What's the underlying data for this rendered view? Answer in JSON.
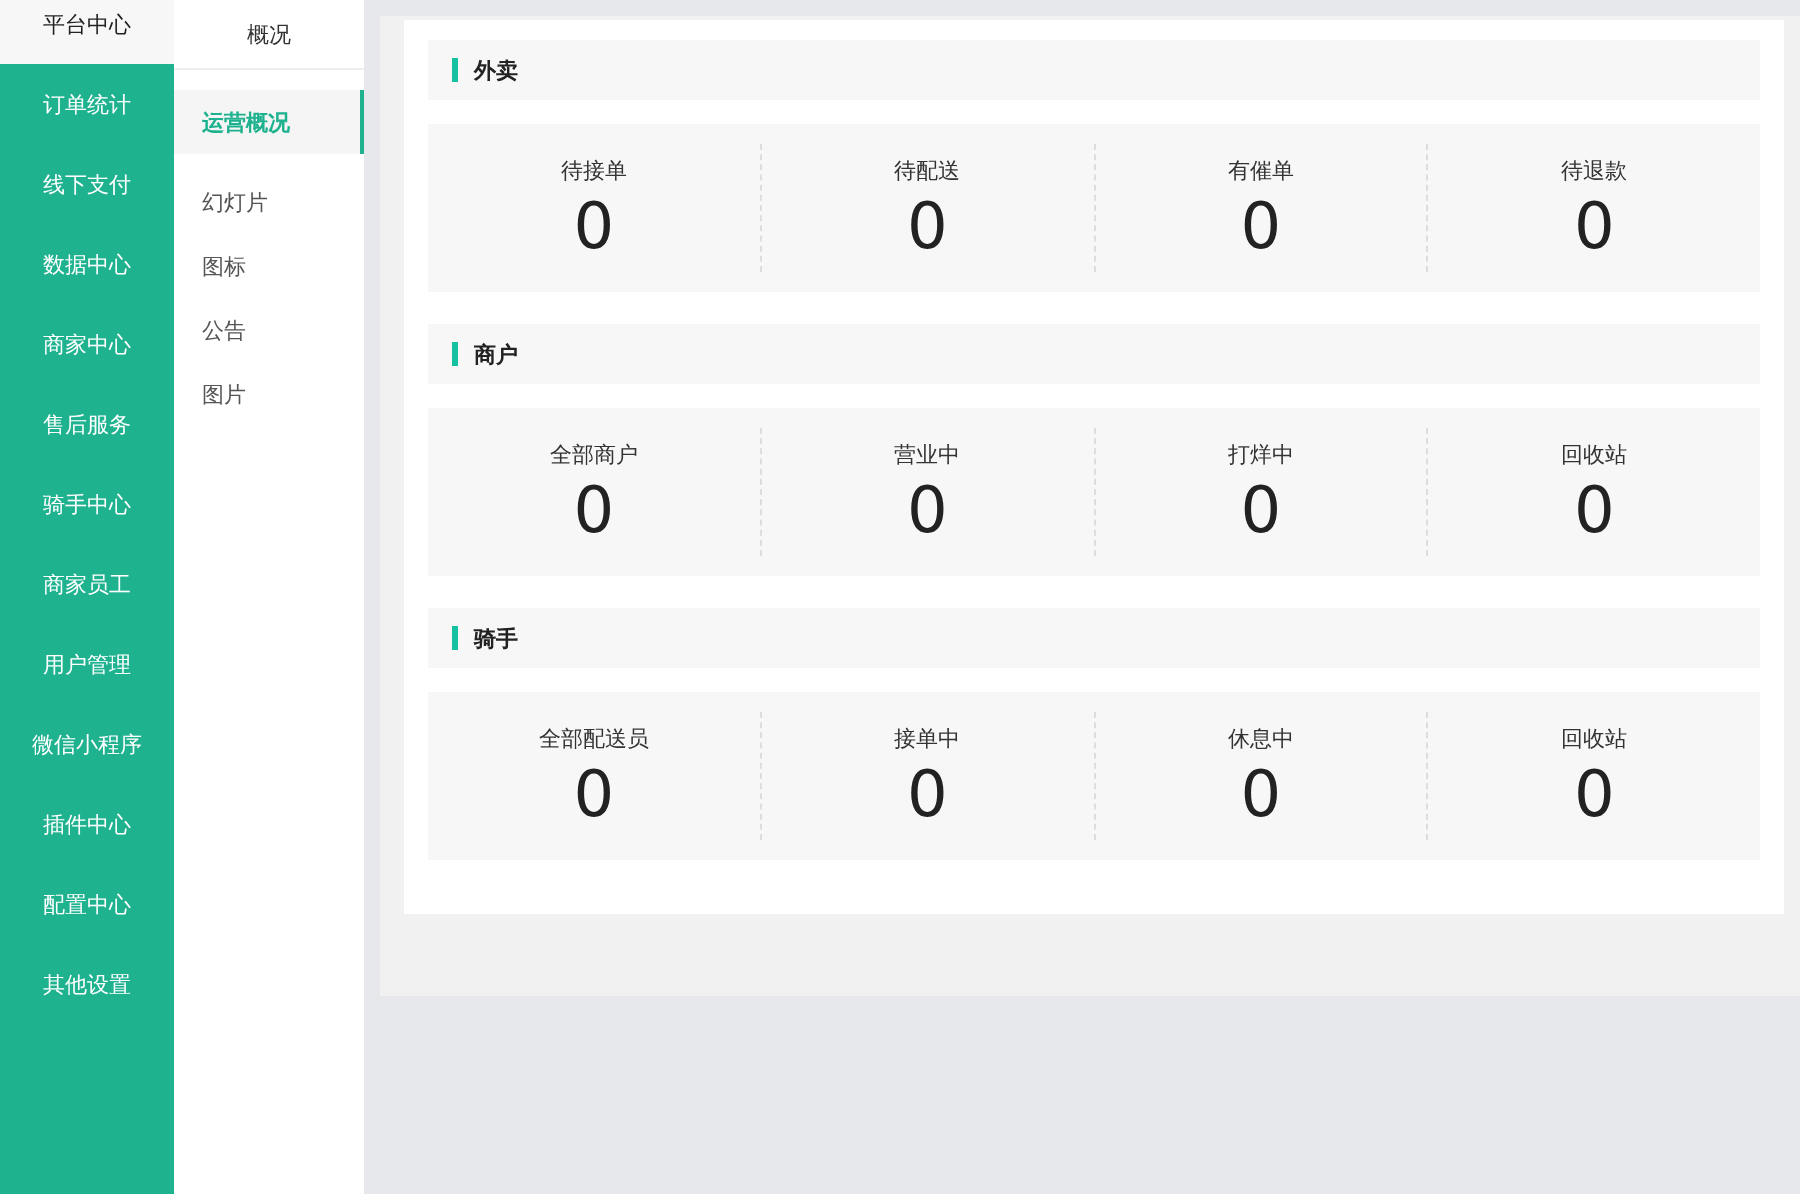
{
  "nav": [
    {
      "label": "平台中心",
      "selected": true
    },
    {
      "label": "订单统计",
      "selected": false
    },
    {
      "label": "线下支付",
      "selected": false
    },
    {
      "label": "数据中心",
      "selected": false
    },
    {
      "label": "商家中心",
      "selected": false
    },
    {
      "label": "售后服务",
      "selected": false
    },
    {
      "label": "骑手中心",
      "selected": false
    },
    {
      "label": "商家员工",
      "selected": false
    },
    {
      "label": "用户管理",
      "selected": false
    },
    {
      "label": "微信小程序",
      "selected": false
    },
    {
      "label": "插件中心",
      "selected": false
    },
    {
      "label": "配置中心",
      "selected": false
    },
    {
      "label": "其他设置",
      "selected": false
    }
  ],
  "subnav": {
    "title": "概况",
    "items": [
      {
        "label": "运营概况",
        "selected": true
      },
      {
        "label": "幻灯片",
        "selected": false
      },
      {
        "label": "图标",
        "selected": false
      },
      {
        "label": "公告",
        "selected": false
      },
      {
        "label": "图片",
        "selected": false
      }
    ]
  },
  "sections": [
    {
      "title": "外卖",
      "stats": [
        {
          "label": "待接单",
          "value": "0"
        },
        {
          "label": "待配送",
          "value": "0"
        },
        {
          "label": "有催单",
          "value": "0"
        },
        {
          "label": "待退款",
          "value": "0"
        }
      ]
    },
    {
      "title": "商户",
      "stats": [
        {
          "label": "全部商户",
          "value": "0"
        },
        {
          "label": "营业中",
          "value": "0"
        },
        {
          "label": "打烊中",
          "value": "0"
        },
        {
          "label": "回收站",
          "value": "0"
        }
      ]
    },
    {
      "title": "骑手",
      "stats": [
        {
          "label": "全部配送员",
          "value": "0"
        },
        {
          "label": "接单中",
          "value": "0"
        },
        {
          "label": "休息中",
          "value": "0"
        },
        {
          "label": "回收站",
          "value": "0"
        }
      ]
    }
  ]
}
